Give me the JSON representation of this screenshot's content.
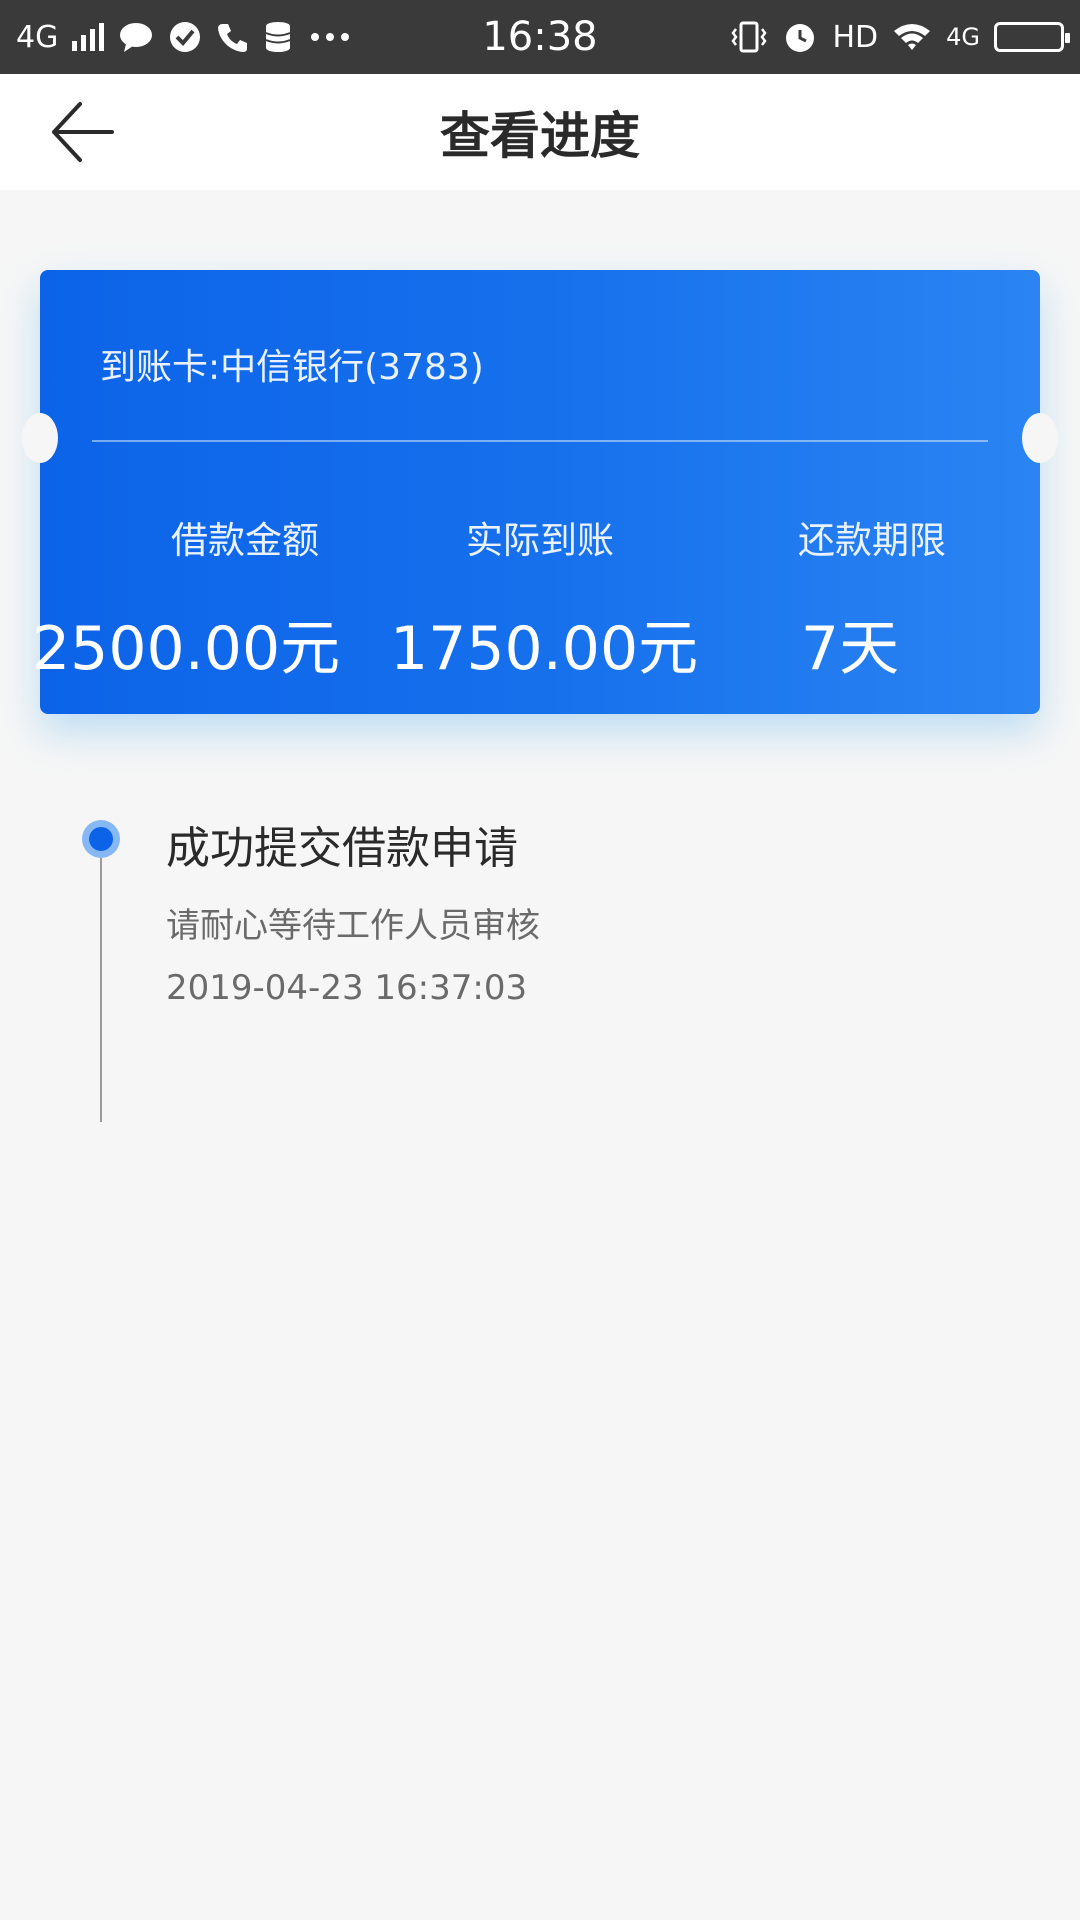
{
  "status_bar": {
    "network": "4G",
    "time": "16:38",
    "hd": "HD",
    "network_right": "4G"
  },
  "nav": {
    "title": "查看进度"
  },
  "card": {
    "account": "到账卡:中信银行(3783)",
    "stats": [
      {
        "label": "借款金额",
        "value": "2500.00元"
      },
      {
        "label": "实际到账",
        "value": "1750.00元"
      },
      {
        "label": "还款期限",
        "value": "7天"
      }
    ]
  },
  "timeline": {
    "steps": [
      {
        "title": "成功提交借款申请",
        "description": "请耐心等待工作人员审核",
        "timestamp": "2019-04-23 16:37:03"
      }
    ]
  },
  "colors": {
    "card_gradient_start": "#0c63e8",
    "card_gradient_end": "#2b84f2",
    "background": "#f6f6f6",
    "status_bar": "#3a3a3a",
    "timeline_dot": "#0c63e8"
  },
  "icons": {
    "back": "arrow-left-icon",
    "status": [
      "signal-icon",
      "message-icon",
      "check-circle-icon",
      "phone-icon",
      "database-icon",
      "more-icon",
      "vibrate-icon",
      "alarm-icon",
      "wifi-icon",
      "battery-icon"
    ]
  }
}
